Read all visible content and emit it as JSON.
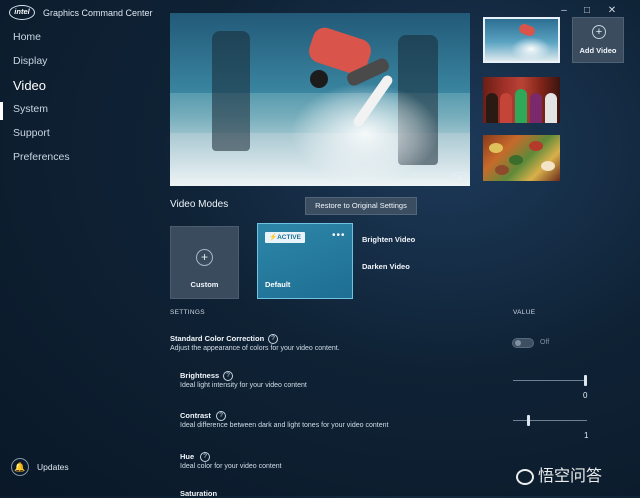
{
  "app": {
    "logo_text": "intel",
    "title": "Graphics Command Center"
  },
  "window_controls": {
    "minimize": "–",
    "maximize": "□",
    "close": "✕"
  },
  "sidebar": {
    "items": [
      {
        "label": "Home"
      },
      {
        "label": "Display"
      },
      {
        "label": "Video",
        "active": true
      },
      {
        "label": "System"
      },
      {
        "label": "Support"
      },
      {
        "label": "Preferences"
      }
    ],
    "updates_label": "Updates",
    "updates_icon": "bell-icon"
  },
  "library": {
    "add_video_label": "Add Video",
    "add_icon": "plus-circle-icon"
  },
  "video_modes": {
    "title": "Video Modes",
    "restore_label": "Restore to Original Settings",
    "custom_label": "Custom",
    "active_badge": "⚡ACTIVE",
    "default_label": "Default",
    "more_label": "•••",
    "brighten_label": "Brighten Video",
    "darken_label": "Darken Video"
  },
  "settings": {
    "header": "SETTINGS",
    "value_header": "VALUE",
    "standard": {
      "title": "Standard Color Correction",
      "desc": "Adjust the appearance of colors for your video content.",
      "toggle_label": "Off"
    },
    "brightness": {
      "title": "Brightness",
      "desc": "Ideal light intensity for your video content",
      "value": "0"
    },
    "contrast": {
      "title": "Contrast",
      "desc": "Ideal difference between dark and light tones for your video content",
      "value": "1"
    },
    "hue": {
      "title": "Hue",
      "desc": "Ideal color for your video content"
    },
    "saturation": {
      "title": "Saturation"
    }
  },
  "help_glyph": "?",
  "watermark": "悟空问答",
  "colors": {
    "accent": "#2d86a8",
    "active_border": "#6cc3e3",
    "tile": "#3a4b5d"
  }
}
